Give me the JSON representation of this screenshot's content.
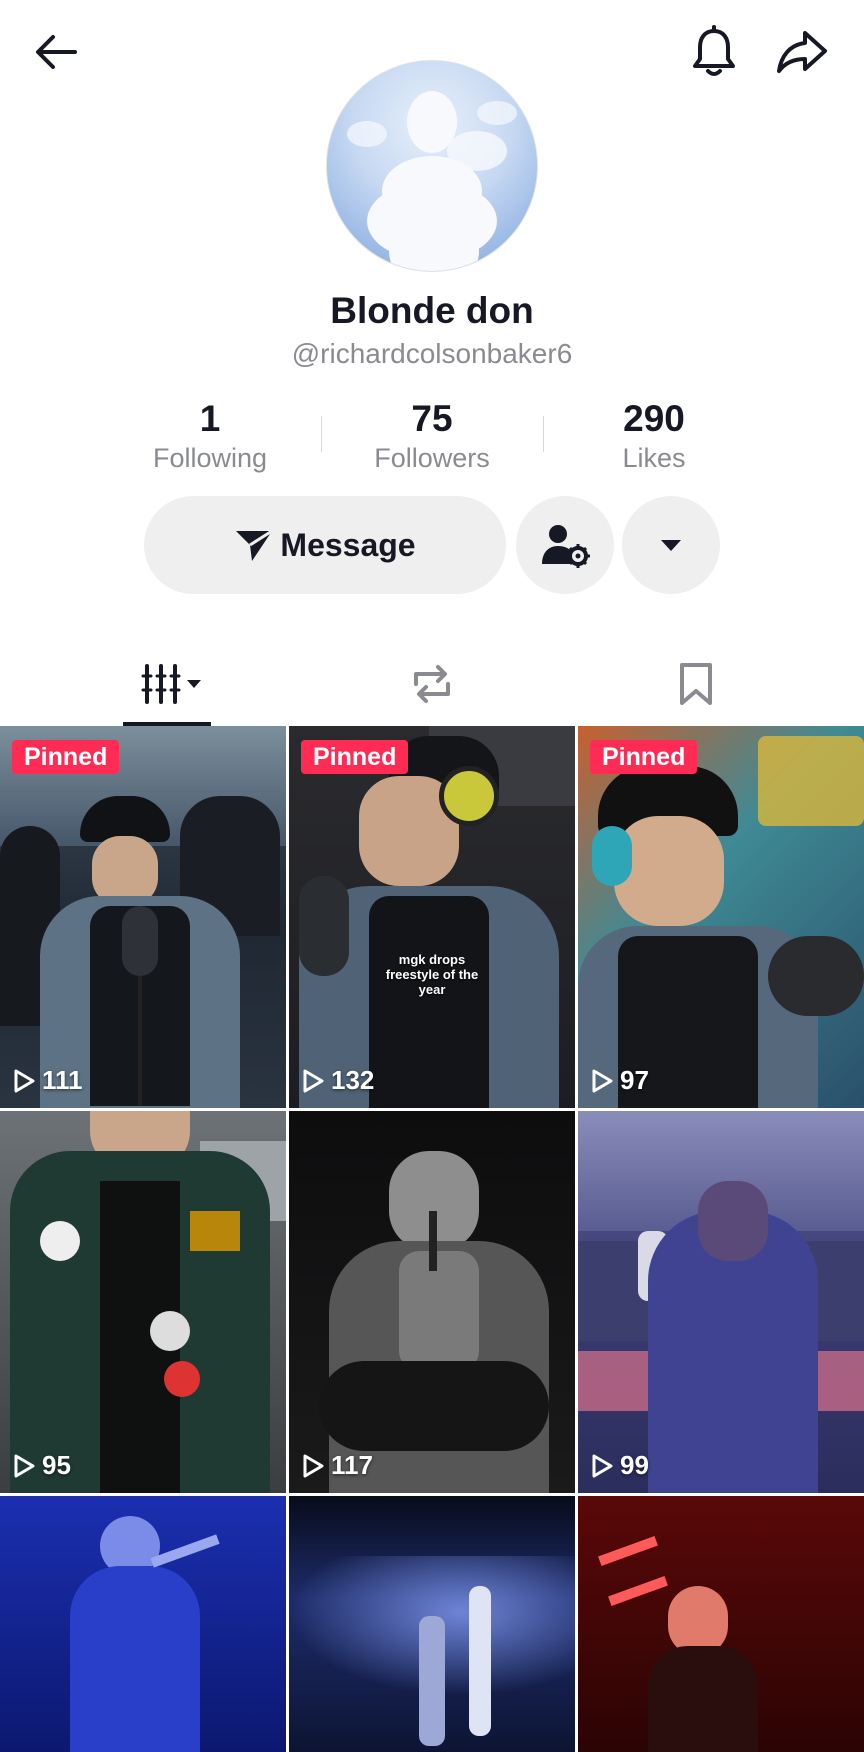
{
  "profile": {
    "display_name": "Blonde don",
    "handle": "@richardcolsonbaker6",
    "stats": [
      {
        "value": "1",
        "label": "Following"
      },
      {
        "value": "75",
        "label": "Followers"
      },
      {
        "value": "290",
        "label": "Likes"
      }
    ]
  },
  "actions": {
    "message_label": "Message"
  },
  "icons": {
    "back": "arrow-left-icon",
    "bell": "bell-icon",
    "share": "share-icon",
    "message": "send-icon",
    "friend_settings": "user-gear-icon",
    "more": "caret-down-icon",
    "tab_videos": "grid-icon",
    "tab_reposts": "repost-icon",
    "tab_saved": "bookmark-icon",
    "play": "play-outline-icon"
  },
  "colors": {
    "pinned_badge": "#fe2c55",
    "button_bg": "#efefef",
    "muted_text": "#8a8b91"
  },
  "videos": [
    {
      "pinned_label": "Pinned",
      "views": "111",
      "caption": ""
    },
    {
      "pinned_label": "Pinned",
      "views": "132",
      "caption": "mgk drops freestyle of the year"
    },
    {
      "pinned_label": "Pinned",
      "views": "97",
      "caption": ""
    },
    {
      "pinned_label": "",
      "views": "95",
      "caption": ""
    },
    {
      "pinned_label": "",
      "views": "117",
      "caption": ""
    },
    {
      "pinned_label": "",
      "views": "99",
      "caption": ""
    },
    {
      "pinned_label": "",
      "views": "",
      "caption": ""
    },
    {
      "pinned_label": "",
      "views": "",
      "caption": ""
    },
    {
      "pinned_label": "",
      "views": "",
      "caption": ""
    }
  ]
}
